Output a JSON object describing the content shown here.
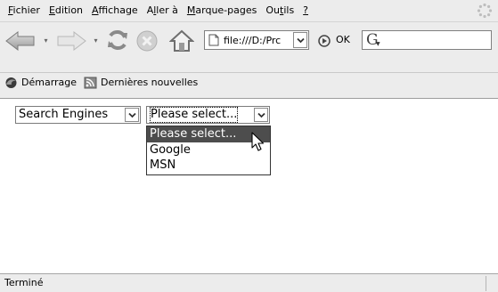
{
  "menubar": {
    "items": [
      {
        "pre": "",
        "key": "F",
        "post": "ichier"
      },
      {
        "pre": "",
        "key": "E",
        "post": "dition"
      },
      {
        "pre": "",
        "key": "A",
        "post": "ffichage"
      },
      {
        "pre": "A",
        "key": "l",
        "post": "ler à"
      },
      {
        "pre": "",
        "key": "M",
        "post": "arque-pages"
      },
      {
        "pre": "Ou",
        "key": "t",
        "post": "ils"
      },
      {
        "pre": "",
        "key": "?",
        "post": ""
      }
    ]
  },
  "navbar": {
    "url": "file:///D:/Prc",
    "go_label": "OK",
    "search_logo": "G"
  },
  "bookmarks": {
    "items": [
      {
        "label": "Démarrage",
        "icon": "firefox-icon"
      },
      {
        "label": "Dernières nouvelles",
        "icon": "rss-icon"
      }
    ]
  },
  "content": {
    "category_select": {
      "value": "Search Engines"
    },
    "engine_select": {
      "value": "Please select...",
      "options": [
        "Please select...",
        "Google",
        "MSN"
      ],
      "highlighted_index": 0,
      "open": true
    }
  },
  "status": {
    "text": "Terminé"
  },
  "colors": {
    "chrome_bg": "#ececec",
    "highlight": "#4d4d4d",
    "content_bg": "#ffffff"
  }
}
